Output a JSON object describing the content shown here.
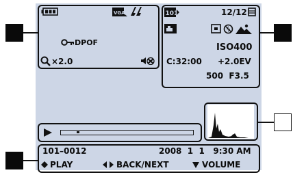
{
  "osd": {
    "movie_size_badge": "VGA",
    "protect_label": "DPOF",
    "zoom_value": "×2.0",
    "folder_badge": "101",
    "image_counter": "12/12",
    "iso": "ISO400",
    "timecode": "C:32:00",
    "exposure_comp": "+2.0EV",
    "shutter_aperture": "500  F3.5",
    "file_number": "101–0012",
    "datetime": "2008  1  1   9:30 AM",
    "play_label": "PLAY",
    "back_next_label": "BACK/NEXT",
    "volume_label": "VOLUME",
    "playback_progress": 0.12
  },
  "colors": {
    "screen_bg": "#cdd6e6",
    "ink": "#0b0b0b"
  },
  "icons": [
    "battery-icon",
    "vga-icon",
    "flash-icon",
    "folder-icon",
    "memory-card-icon",
    "camera-folder-icon",
    "play-mode-icon",
    "no-flash-icon",
    "landscape-icon",
    "key-icon",
    "magnifier-icon",
    "no-sound-icon",
    "histogram-icon",
    "play-triangle-icon",
    "progress-bar"
  ]
}
